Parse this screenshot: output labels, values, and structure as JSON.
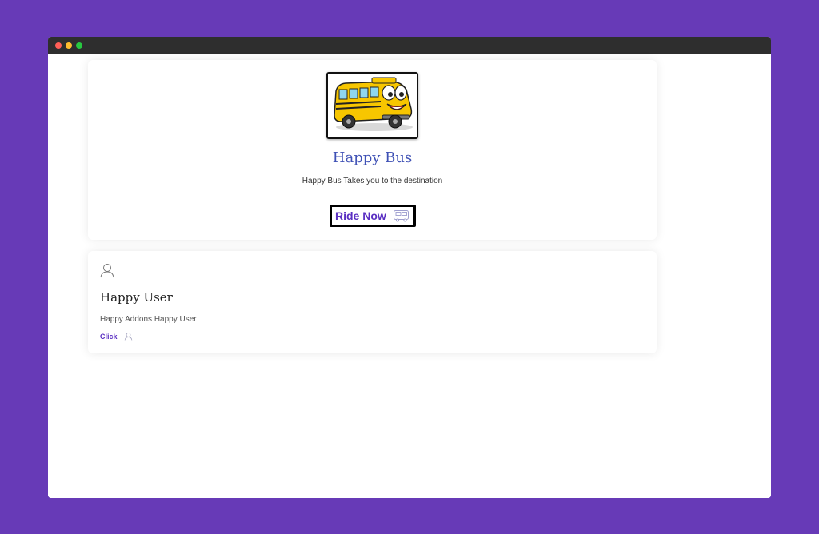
{
  "colors": {
    "background": "#673ab7",
    "titlebar": "#2e2e2e",
    "accent": "#5a2fc2",
    "title_blue": "#3f51b5"
  },
  "window_controls": [
    "close",
    "minimize",
    "maximize"
  ],
  "bus_card": {
    "image_icon": "school-bus-cartoon",
    "title": "Happy Bus",
    "description": "Happy Bus Takes you to the destination",
    "button_label": "Ride Now",
    "button_icon": "bus-icon"
  },
  "user_card": {
    "icon": "user-icon",
    "title": "Happy User",
    "description": "Happy Addons Happy User",
    "link_label": "Click",
    "link_icon": "user-icon"
  }
}
